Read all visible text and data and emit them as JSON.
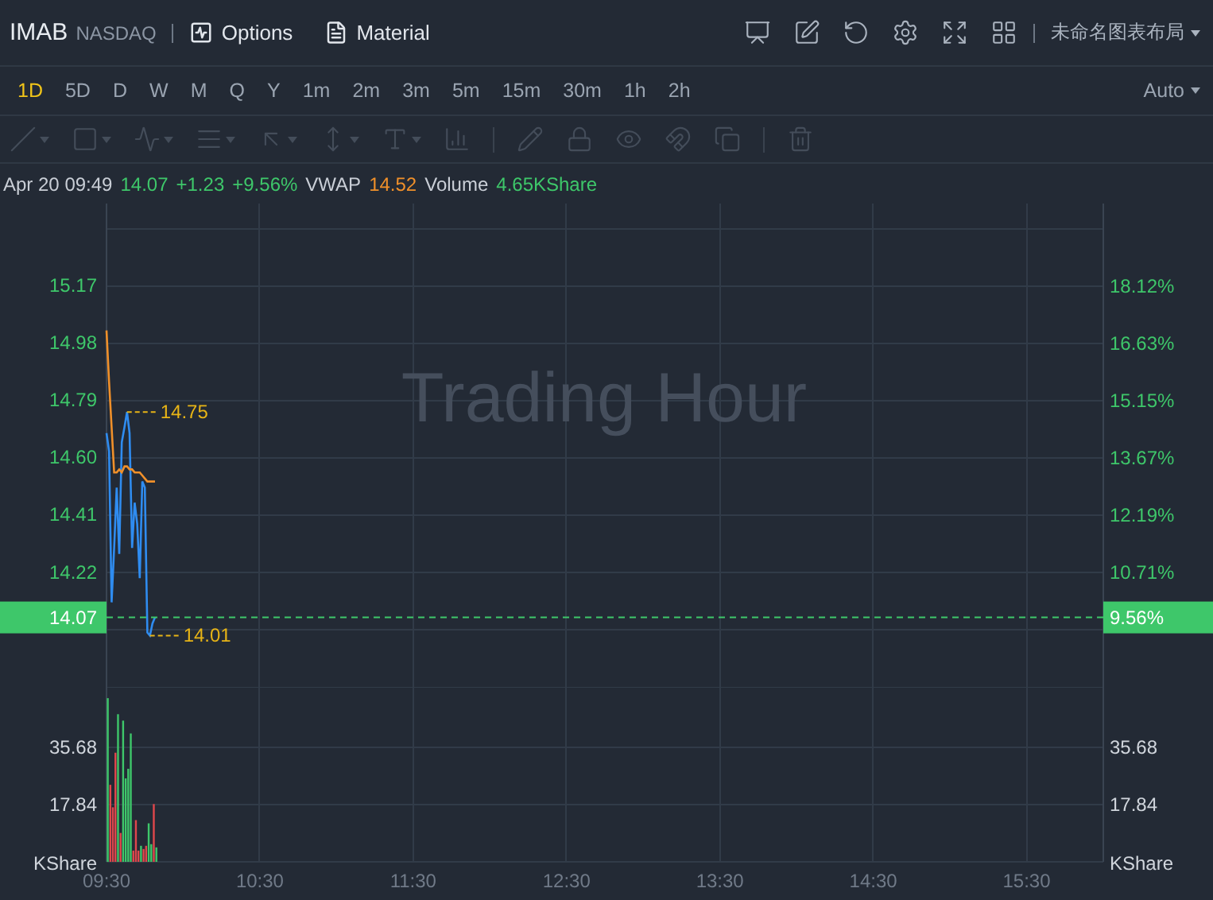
{
  "header": {
    "symbol": "IMAB",
    "exchange": "NASDAQ",
    "links": [
      {
        "kind": "options",
        "label": "Options"
      },
      {
        "kind": "material",
        "label": "Material"
      }
    ],
    "actions": [
      {
        "kind": "screen"
      },
      {
        "kind": "edit"
      },
      {
        "kind": "undo"
      },
      {
        "kind": "settings"
      },
      {
        "kind": "fullscreen"
      },
      {
        "kind": "layout"
      }
    ],
    "layout_name": "未命名图表布局"
  },
  "timeframes": [
    {
      "label": "1D",
      "selected": true
    },
    {
      "label": "5D",
      "selected": false
    },
    {
      "label": "D",
      "selected": false
    },
    {
      "label": "W",
      "selected": false
    },
    {
      "label": "M",
      "selected": false
    },
    {
      "label": "Q",
      "selected": false
    },
    {
      "label": "Y",
      "selected": false
    },
    {
      "label": "1m",
      "selected": false
    },
    {
      "label": "2m",
      "selected": false
    },
    {
      "label": "3m",
      "selected": false
    },
    {
      "label": "5m",
      "selected": false
    },
    {
      "label": "15m",
      "selected": false
    },
    {
      "label": "30m",
      "selected": false
    },
    {
      "label": "1h",
      "selected": false
    },
    {
      "label": "2h",
      "selected": false
    }
  ],
  "scale_mode": "Auto",
  "tool_groups": [
    [
      {
        "kind": "line",
        "dropdown": true,
        "disabled": true
      },
      {
        "kind": "rectangle",
        "dropdown": true,
        "disabled": true
      },
      {
        "kind": "pattern",
        "dropdown": true,
        "disabled": true
      },
      {
        "kind": "fib",
        "dropdown": true,
        "disabled": true
      },
      {
        "kind": "arrow",
        "dropdown": true,
        "disabled": true
      },
      {
        "kind": "measure",
        "dropdown": true,
        "disabled": true
      },
      {
        "kind": "text",
        "dropdown": true,
        "disabled": true
      },
      {
        "kind": "bars",
        "dropdown": false,
        "disabled": true
      }
    ],
    [
      {
        "kind": "pencil",
        "dropdown": false,
        "disabled": true
      },
      {
        "kind": "lock",
        "dropdown": false,
        "disabled": true
      },
      {
        "kind": "eye",
        "dropdown": false,
        "disabled": true
      },
      {
        "kind": "magnet",
        "dropdown": false,
        "disabled": true
      },
      {
        "kind": "copy",
        "dropdown": false,
        "disabled": true
      }
    ],
    [
      {
        "kind": "trash",
        "dropdown": false,
        "disabled": true
      }
    ]
  ],
  "info": {
    "time": "Apr 20 09:49",
    "price": "14.07",
    "change": "+1.23",
    "change_pct": "+9.56%",
    "vwap_label": "VWAP",
    "vwap": "14.52",
    "volume_label": "Volume",
    "volume": "4.65KShare"
  },
  "price_chart": {
    "watermark": "Trading Hour",
    "right_axis": [
      "18.12%",
      "16.63%",
      "15.15%",
      "13.67%",
      "12.19%",
      "10.71%"
    ],
    "high_label": "14.75",
    "low_label": "14.01",
    "last_price": "14.07",
    "last_pct": "9.56%",
    "chart_data": {
      "type": "line",
      "grid": true,
      "x": [
        570,
        571,
        572,
        573,
        574,
        575,
        576,
        577,
        578,
        579,
        580,
        581,
        582,
        583,
        584,
        585,
        586,
        587,
        588,
        589
      ],
      "xlim": [
        570,
        960
      ],
      "ylim": [
        13.84,
        15.44
      ],
      "ref_lines": [
        {
          "axis": "y",
          "value": 14.07,
          "color": "#3ec76a"
        }
      ],
      "yticks": [
        {
          "value": 15.17,
          "label": "15.17"
        },
        {
          "value": 14.98,
          "label": "14.98"
        },
        {
          "value": 14.79,
          "label": "14.79"
        },
        {
          "value": 14.6,
          "label": "14.60"
        },
        {
          "value": 14.41,
          "label": "14.41"
        },
        {
          "value": 14.22,
          "label": "14.22"
        }
      ],
      "series": [
        {
          "color": "#2f8cf0",
          "values": [
            14.68,
            14.62,
            14.12,
            14.3,
            14.5,
            14.28,
            14.65,
            14.7,
            14.75,
            14.68,
            14.3,
            14.45,
            14.38,
            14.2,
            14.52,
            14.5,
            14.02,
            14.01,
            14.05,
            14.07
          ]
        },
        {
          "color": "#f0902a",
          "values": [
            15.02,
            14.85,
            14.7,
            14.55,
            14.55,
            14.56,
            14.55,
            14.57,
            14.57,
            14.56,
            14.56,
            14.55,
            14.55,
            14.55,
            14.54,
            14.53,
            14.52,
            14.52,
            14.52,
            14.52
          ]
        }
      ]
    }
  },
  "volume_chart": {
    "right_axis": [
      "35.68",
      "17.84"
    ],
    "right_unit": "KShare",
    "chart_data": {
      "type": "bar",
      "grid": true,
      "ylabel": "KShare",
      "stacked": true,
      "ylim": [
        0,
        54.5
      ],
      "x": [
        570,
        571,
        572,
        573,
        574,
        575,
        576,
        577,
        578,
        579,
        580,
        581,
        582,
        583,
        584,
        585,
        586,
        587,
        588,
        589
      ],
      "xlim": [
        570,
        960
      ],
      "xticks": [
        {
          "value": 570,
          "label": "09:30"
        },
        {
          "value": 630,
          "label": "10:30"
        },
        {
          "value": 690,
          "label": "11:30"
        },
        {
          "value": 750,
          "label": "12:30"
        },
        {
          "value": 810,
          "label": "13:30"
        },
        {
          "value": 870,
          "label": "14:30"
        },
        {
          "value": 930,
          "label": "15:30"
        }
      ],
      "yticks": [
        {
          "value": 17.84,
          "label": "17.84"
        },
        {
          "value": 35.68,
          "label": "35.68"
        }
      ],
      "series": [
        {
          "color": "#3ec76a",
          "values": [
            51,
            0,
            0,
            0,
            46,
            0,
            44,
            26,
            29,
            40,
            0,
            0,
            0,
            5,
            0,
            0,
            12,
            5.5,
            0,
            4.5
          ]
        },
        {
          "color": "#e0474c",
          "values": [
            0,
            24,
            17,
            34,
            0,
            9,
            0,
            0,
            0,
            0,
            3.5,
            13,
            3.5,
            0,
            4,
            5,
            0,
            0,
            18,
            0
          ]
        }
      ]
    }
  }
}
